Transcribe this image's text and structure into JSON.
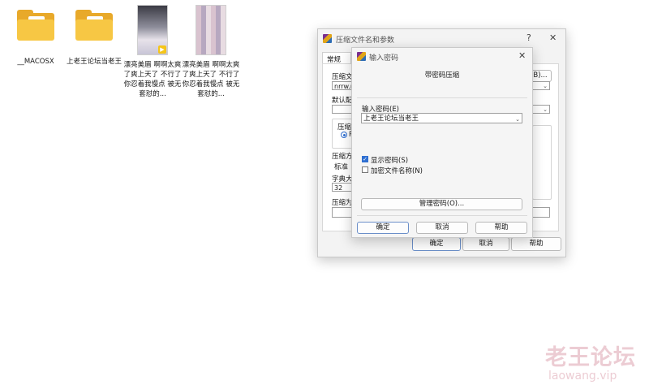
{
  "desktop": {
    "items": [
      {
        "label": "__MACOSX",
        "type": "folder"
      },
      {
        "label": "上老王论坛当老王",
        "type": "folder"
      },
      {
        "label": "漂亮美眉 啊啊太爽了爽上天了 不行了 你忍着我慢点 被无套怼的...",
        "type": "video-thumbnail"
      },
      {
        "label": "漂亮美眉 啊啊太爽了爽上天了 不行了 你忍着我慢点 被无套怼的...",
        "type": "image-thumbnail"
      }
    ]
  },
  "archive_dialog": {
    "title": "压缩文件名和参数",
    "help_glyph": "?",
    "close_glyph": "✕",
    "tab_general": "常规",
    "label_archive_name": "压缩文",
    "archive_name_value": "nrrw.r",
    "browse_button": "B)...",
    "label_default_profile": "默认配",
    "label_archive_format": "压缩",
    "radio_rar_partial": "R",
    "label_compression_method": "压缩方",
    "compression_method_value": "标准",
    "label_dictionary_size": "字典大",
    "dictionary_size_value": "32",
    "label_split_volumes": "压缩为",
    "ok_button": "确定",
    "cancel_button": "取消",
    "help_button": "帮助"
  },
  "password_dialog": {
    "title": "输入密码",
    "close_glyph": "✕",
    "heading": "带密码压缩",
    "label_enter_password": "输入密码(E)",
    "password_value": "上老王论坛当老王",
    "show_password_label": "显示密码(S)",
    "show_password_checked": true,
    "encrypt_names_label": "加密文件名称(N)",
    "encrypt_names_checked": false,
    "manage_passwords_button": "管理密码(O)...",
    "ok_button": "确定",
    "cancel_button": "取消",
    "help_button": "帮助"
  },
  "watermark": {
    "cn": "老王论坛",
    "url": "laowang.vip"
  }
}
